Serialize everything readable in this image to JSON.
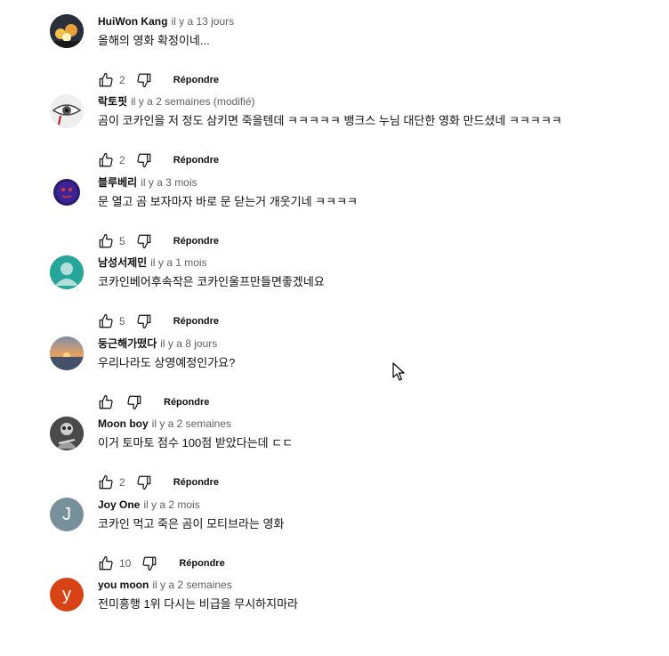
{
  "reply_label": "Répondre",
  "comments": [
    {
      "author": "HuiWon Kang",
      "time": "il y a 13 jours",
      "text": "올해의 영화 확정이네...",
      "likes": "2"
    },
    {
      "author": "락토핏",
      "time": "il y a 2 semaines (modifié)",
      "text": "곰이 코카인을 저 정도 삼키면 죽을텐데 ㅋㅋㅋㅋㅋ 뱅크스 누님 대단한 영화 만드셨네 ㅋㅋㅋㅋㅋ",
      "likes": "2"
    },
    {
      "author": "블루베리",
      "time": "il y a 3 mois",
      "text": "문 열고 곰 보자마자 바로 문 닫는거 개웃기네 ㅋㅋㅋㅋ",
      "likes": "5"
    },
    {
      "author": "남성서제민",
      "time": "il y a 1 mois",
      "text": "코카인베어후속작은 코카인울프만들면좋겠네요",
      "likes": "5"
    },
    {
      "author": "둥근해가떴다",
      "time": "il y a 8 jours",
      "text": "우리나라도 상영예정인가요?",
      "likes": ""
    },
    {
      "author": "Moon boy",
      "time": "il y a 2 semaines",
      "text": "이거 토마토 점수 100점 받았다는데 ㄷㄷ",
      "likes": "2"
    },
    {
      "author": "Joy One",
      "time": "il y a 2 mois",
      "text": "코카인 먹고 죽은 곰이 모티브라는 영화",
      "likes": "10",
      "avatar_letter": "J"
    },
    {
      "author": "you moon",
      "time": "il y a 2 semaines",
      "text": "전미흥행 1위  다시는 비급을 무시하지마라",
      "likes": "",
      "avatar_letter": "y"
    }
  ],
  "colors": {
    "author": "#0f0f0f",
    "meta": "#606060",
    "avatar_joy": "#78909c",
    "avatar_you": "#d84315",
    "avatar_person": "#26a69a"
  }
}
